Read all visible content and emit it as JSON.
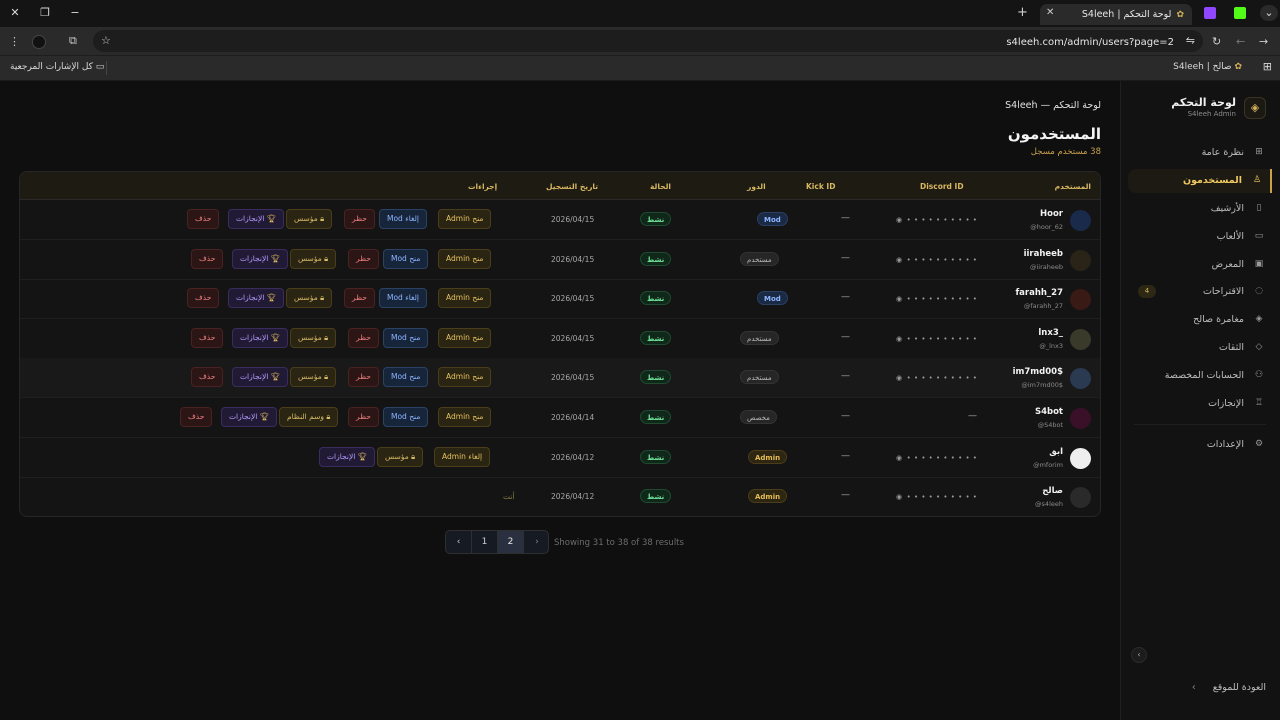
{
  "browser": {
    "tab_title": "لوحة التحكم | S4leeh",
    "url": "s4leeh.com/admin/users?page=2",
    "bookmark_folder": "كل الإشارات المرجعية",
    "bookmark_item": "صالح | S4leeh"
  },
  "sidebar": {
    "brand_title": "لوحة التحكم",
    "brand_sub": "S4leeh Admin",
    "items": [
      {
        "label": "نظرة عامة",
        "icon": "grid-icon"
      },
      {
        "label": "المستخدمون",
        "icon": "user-icon",
        "active": true
      },
      {
        "label": "الأرشيف",
        "icon": "trash-icon"
      },
      {
        "label": "الألعاب",
        "icon": "gamepad-icon"
      },
      {
        "label": "المعرض",
        "icon": "image-icon"
      },
      {
        "label": "الاقتراحات",
        "icon": "lightbulb-icon",
        "badge": "4"
      },
      {
        "label": "مغامرة صالح",
        "icon": "layers-icon"
      },
      {
        "label": "الثقات",
        "icon": "tag-icon"
      },
      {
        "label": "الحسابات المخصصة",
        "icon": "users-icon"
      },
      {
        "label": "الإنجازات",
        "icon": "medal-icon"
      },
      {
        "label": "الإعدادات",
        "icon": "settings-icon"
      }
    ],
    "back_label": "العودة للموقع"
  },
  "main": {
    "breadcrumb": "لوحة التحكم — S4leeh",
    "title": "المستخدمون",
    "subtitle": "38 مستخدم مسجل"
  },
  "table": {
    "headers": {
      "user": "المستخدم",
      "discord": "Discord ID",
      "kick": "Kick ID",
      "role": "الدور",
      "status": "الحالة",
      "date": "تاريخ التسجيل",
      "actions": "إجراءات"
    },
    "masked": "• • • • • • • • • •",
    "dash": "—",
    "status_active": "نشط",
    "rows": [
      {
        "name": "Hoor",
        "handle": "@hoor_62",
        "role": "Mod",
        "role_type": "mod",
        "date": "2026/04/15",
        "btn_admin": "منح Admin",
        "btn_mod": "إلغاء Mod",
        "btn_ban": "حظر",
        "btn_found": "مؤسس",
        "btn_ach": "الإنجازات",
        "btn_del": "حذف"
      },
      {
        "name": "iiraheeb",
        "handle": "@iiraheeb",
        "role": "مستخدم",
        "role_type": "user",
        "date": "2026/04/15",
        "btn_admin": "منح Admin",
        "btn_mod": "منح Mod",
        "btn_ban": "حظر",
        "btn_found": "مؤسس",
        "btn_ach": "الإنجازات",
        "btn_del": "حذف"
      },
      {
        "name": "farahh_27",
        "handle": "@farahh_27",
        "role": "Mod",
        "role_type": "mod",
        "date": "2026/04/15",
        "btn_admin": "منح Admin",
        "btn_mod": "إلغاء Mod",
        "btn_ban": "حظر",
        "btn_found": "مؤسس",
        "btn_ach": "الإنجازات",
        "btn_del": "حذف"
      },
      {
        "name": "lnx3_",
        "handle": "@_lnx3",
        "role": "مستخدم",
        "role_type": "user",
        "date": "2026/04/15",
        "btn_admin": "منح Admin",
        "btn_mod": "منح Mod",
        "btn_ban": "حظر",
        "btn_found": "مؤسس",
        "btn_ach": "الإنجازات",
        "btn_del": "حذف"
      },
      {
        "name": "im7md00$",
        "handle": "@im7md00$",
        "role": "مستخدم",
        "role_type": "user",
        "date": "2026/04/15",
        "btn_admin": "منح Admin",
        "btn_mod": "منح Mod",
        "btn_ban": "حظر",
        "btn_found": "مؤسس",
        "btn_ach": "الإنجازات",
        "btn_del": "حذف"
      },
      {
        "name": "S4bot",
        "handle": "@S4bot",
        "role": "مخصص",
        "role_type": "user",
        "date": "2026/04/14",
        "btn_admin": "منح Admin",
        "btn_mod": "منح Mod",
        "btn_ban": "حظر",
        "btn_found": "وسم النظام",
        "btn_ach": "الإنجازات",
        "btn_del": "حذف"
      },
      {
        "name": "ابق",
        "handle": "@mforim",
        "role": "Admin",
        "role_type": "admin",
        "date": "2026/04/12",
        "btn_admin": "إلغاء Admin",
        "btn_found": "مؤسس",
        "btn_ach": "الإنجازات"
      },
      {
        "name": "صالح",
        "handle": "@s4leeh",
        "role": "Admin",
        "role_type": "admin",
        "date": "2026/04/12",
        "you": "أنت"
      }
    ]
  },
  "pagination": {
    "pages": [
      "1",
      "2"
    ],
    "current": "2",
    "info": "Showing 31 to 38 of 38 results"
  },
  "colors": {
    "accent": "#c9a24a",
    "bg": "#0f0f0f",
    "success": "#6fe39a"
  }
}
